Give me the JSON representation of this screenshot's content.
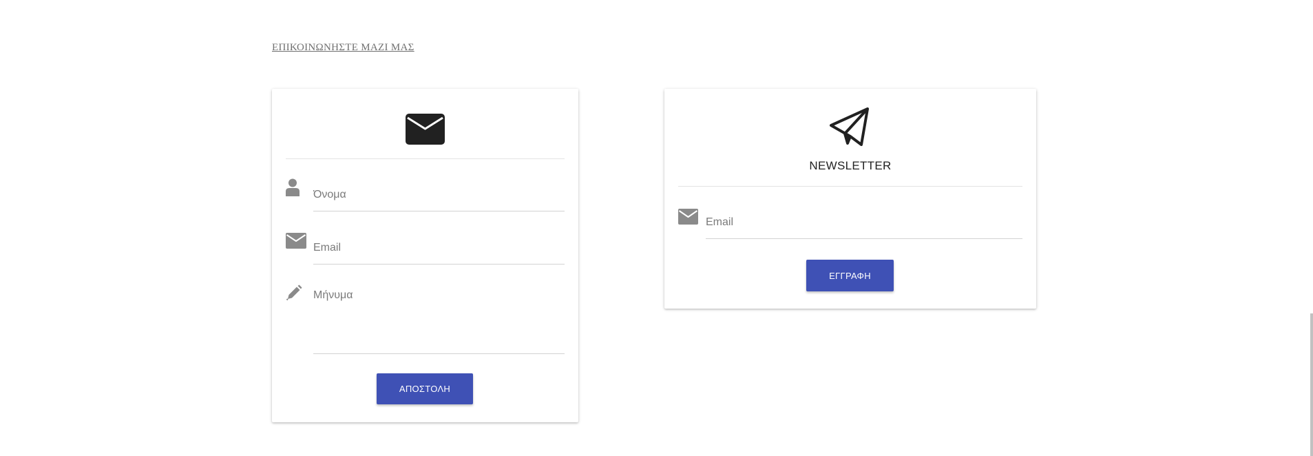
{
  "section": {
    "title": "ΕΠΙΚΟΙΝΩΝΗΣΤΕ ΜΑΖΙ ΜΑΣ"
  },
  "contact_form": {
    "header_icon": "envelope-icon",
    "fields": {
      "name": {
        "icon": "user-icon",
        "placeholder": "Όνομα",
        "value": ""
      },
      "email": {
        "icon": "envelope-icon",
        "placeholder": "Email",
        "value": ""
      },
      "message": {
        "icon": "pencil-icon",
        "placeholder": "Μήνυμα",
        "value": ""
      }
    },
    "submit_label": "ΑΠΟΣΤΟΛΗ"
  },
  "newsletter": {
    "header_icon": "paper-plane-icon",
    "title": "NEWSLETTER",
    "fields": {
      "email": {
        "icon": "envelope-icon",
        "placeholder": "Email",
        "value": ""
      }
    },
    "submit_label": "ΕΓΓΡΑΦΗ"
  },
  "colors": {
    "accent": "#3f51b5",
    "icon_dark": "#212121",
    "icon_muted": "#8a8a8a",
    "divider": "#e3e3e3"
  }
}
